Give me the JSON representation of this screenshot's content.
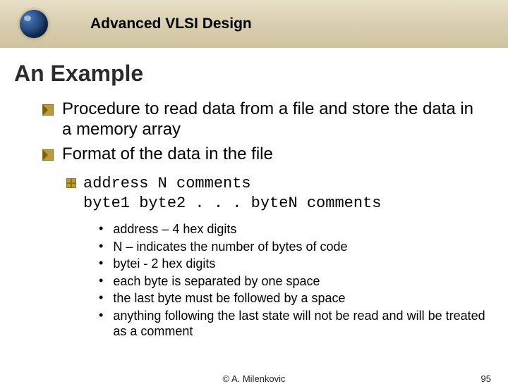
{
  "header": {
    "course_title": "Advanced VLSI Design"
  },
  "slide": {
    "title": "An Example",
    "bullets_lvl1": [
      "Procedure to read data from a file and store the data in a memory array",
      "Format of the data in the file"
    ],
    "code_lines": [
      "address N comments",
      "byte1 byte2 . . . byteN comments"
    ],
    "details": [
      "address – 4 hex digits",
      "N – indicates the number of bytes of code",
      "bytei  - 2 hex digits",
      "each byte is separated by one space",
      "the last byte must be followed by a space",
      "anything following the last state will not be read and will be treated as a comment"
    ]
  },
  "footer": {
    "copyright": "© A. Milenkovic",
    "page_number": "95"
  }
}
